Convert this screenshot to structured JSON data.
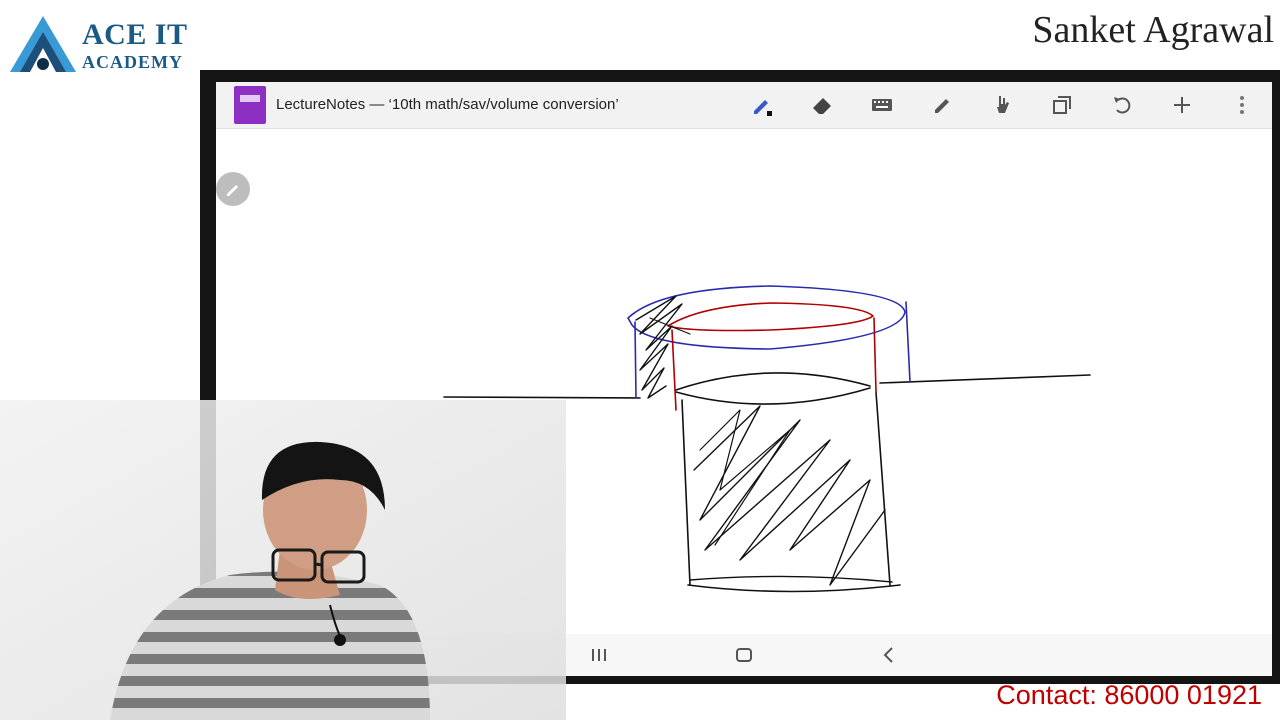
{
  "logo": {
    "line1": "ACE IT",
    "line2": "ACADEMY",
    "icon": "triangle-logo-icon",
    "color": "#1c5a86"
  },
  "presenter": {
    "name": "Sanket Agrawal"
  },
  "app": {
    "title": "LectureNotes — ‘10th math/sav/volume conversion’",
    "icon": "notebook-icon",
    "tools": [
      "pen-icon",
      "eraser-icon",
      "keyboard-icon",
      "highlighter-icon",
      "hand-icon",
      "copy-icon",
      "undo-icon",
      "add-icon",
      "more-vert-icon"
    ],
    "floating_tool": "pen-icon"
  },
  "system_nav": [
    "recent-apps-icon",
    "home-icon",
    "back-icon"
  ],
  "contact": "Contact: 86000 01921",
  "colors": {
    "ink_black": "#111111",
    "ink_blue": "#2a2ab0",
    "ink_red": "#b00000",
    "accent_purple": "#8e2fc4",
    "contact_red": "#c00000"
  }
}
